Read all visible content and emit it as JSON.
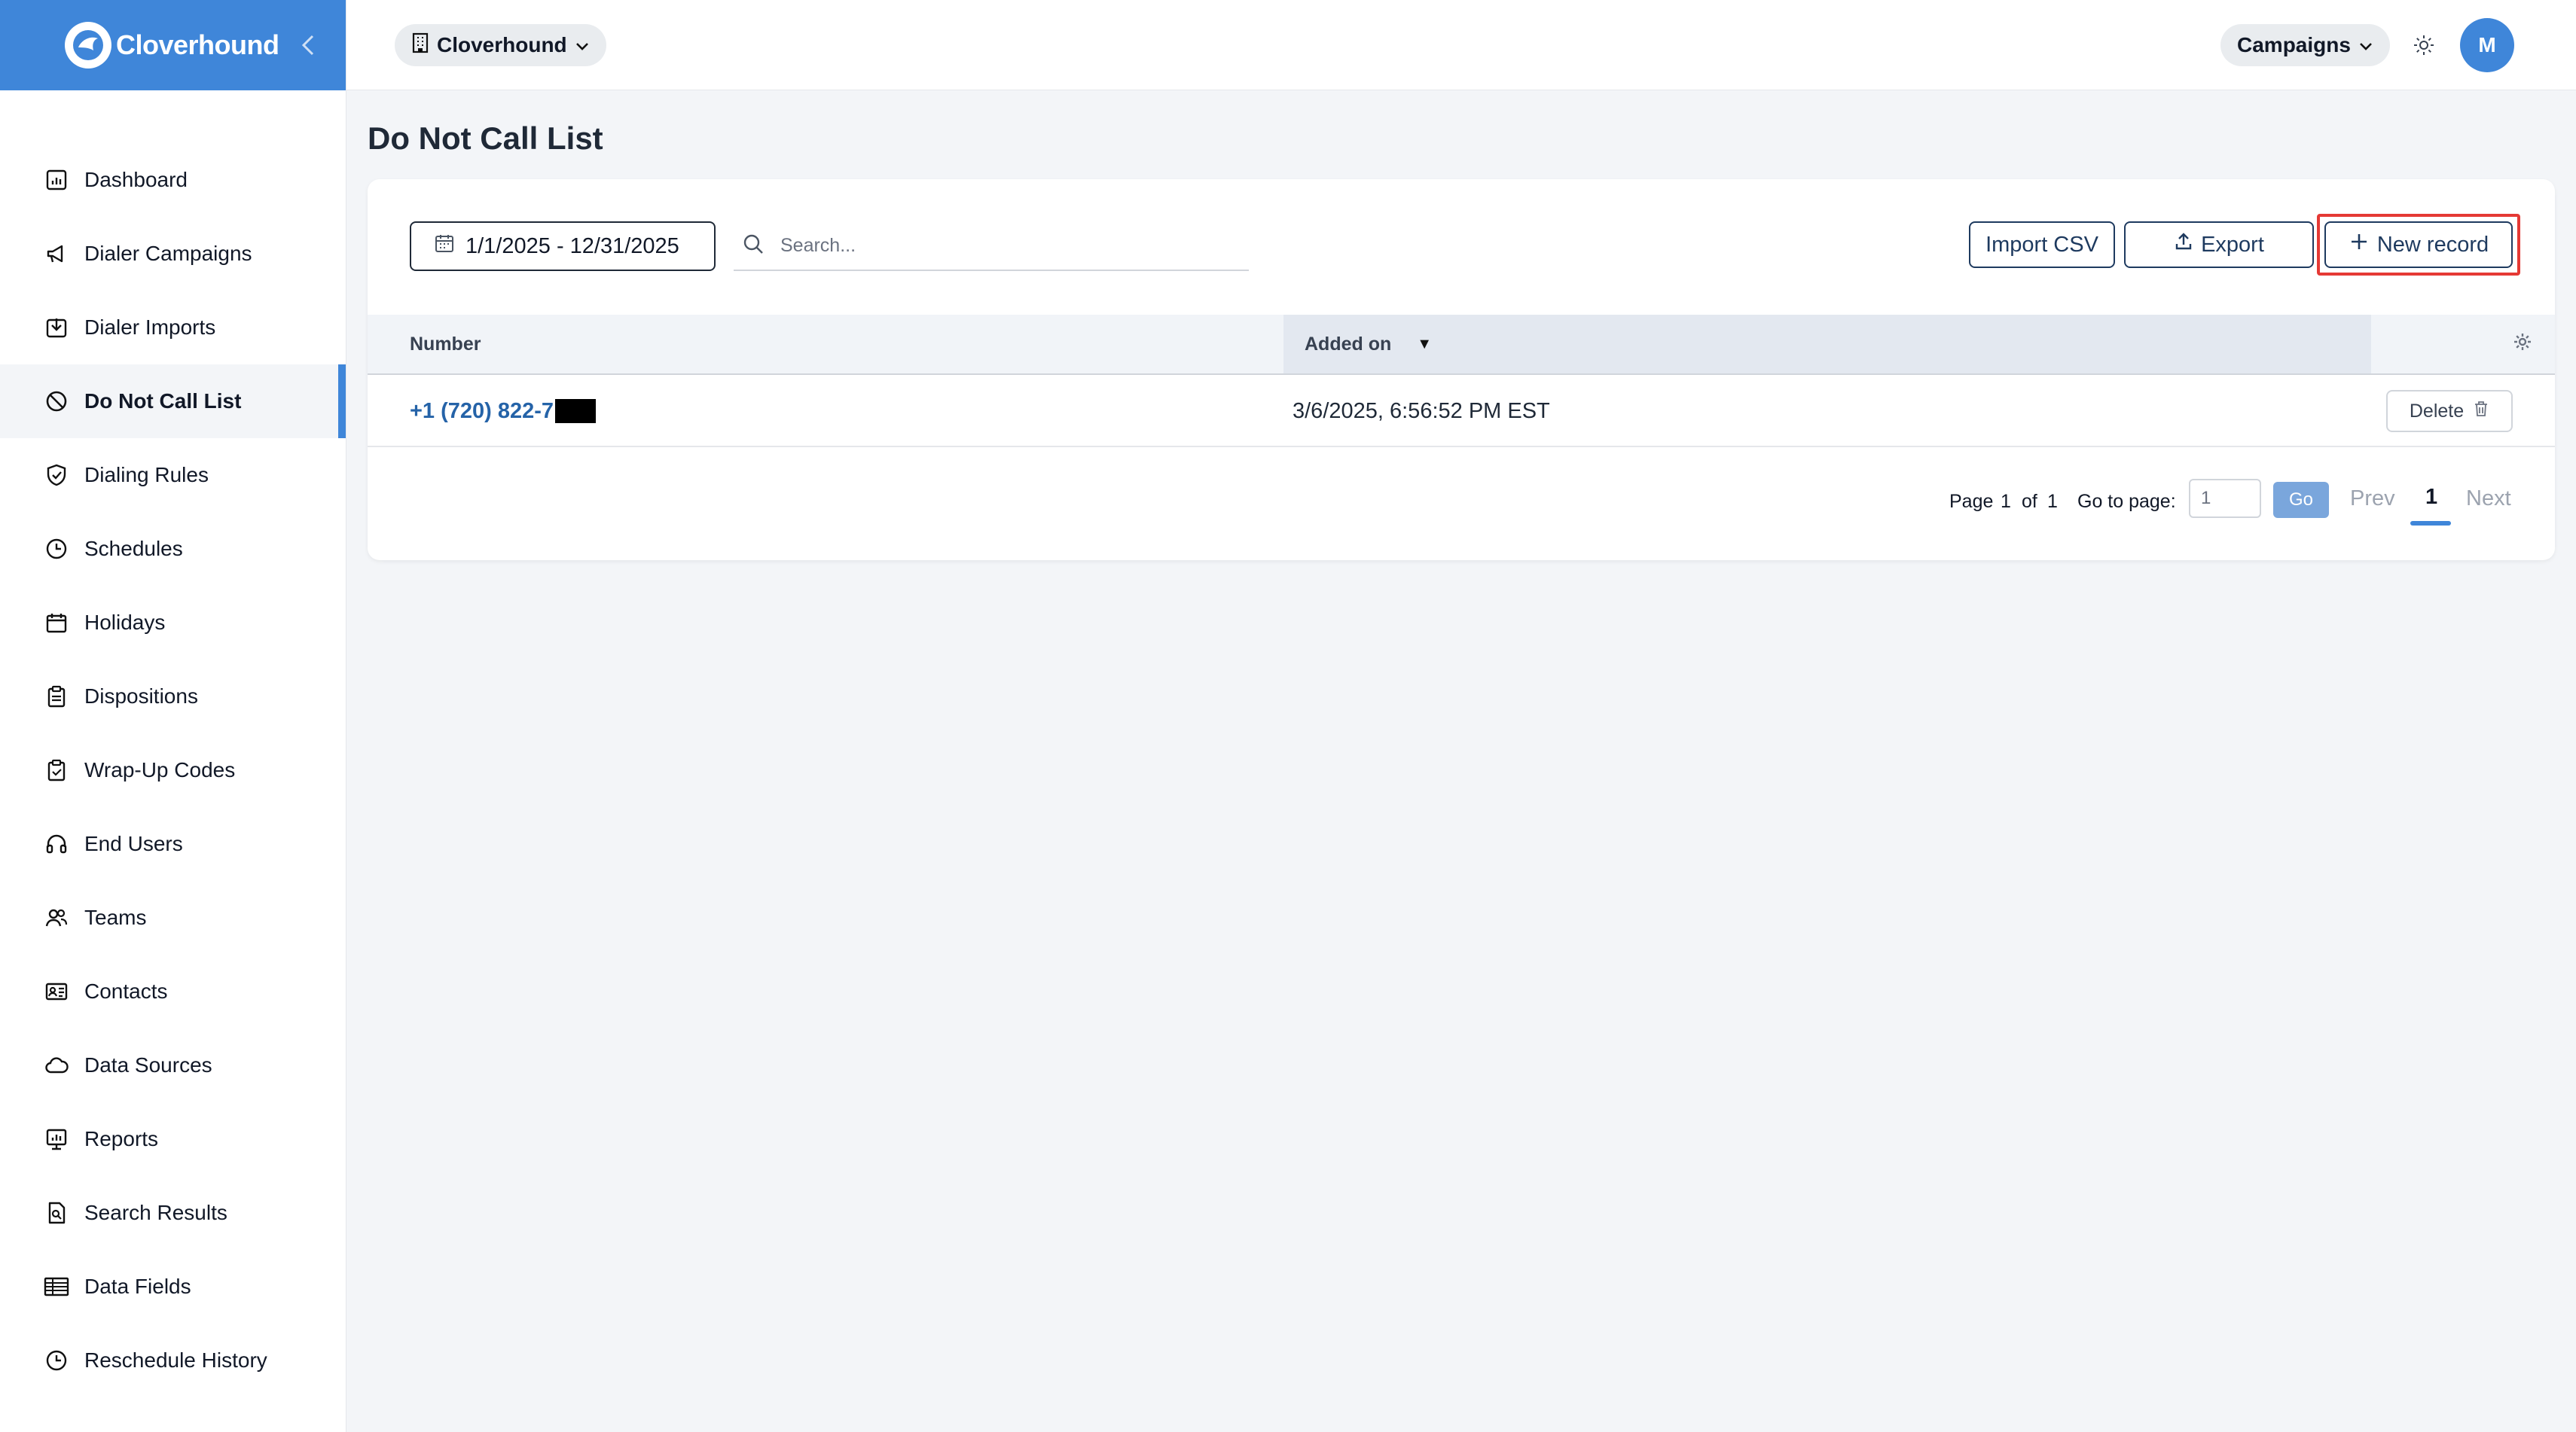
{
  "brand": {
    "name": "Cloverhound"
  },
  "colors": {
    "accent": "#3f86d9",
    "link": "#2563a8",
    "highlight": "#e53935"
  },
  "sidebar": {
    "items": [
      {
        "label": "Dashboard",
        "icon": "chart-icon"
      },
      {
        "label": "Dialer Campaigns",
        "icon": "megaphone-icon"
      },
      {
        "label": "Dialer Imports",
        "icon": "import-icon"
      },
      {
        "label": "Do Not Call List",
        "icon": "ban-icon",
        "active": true
      },
      {
        "label": "Dialing Rules",
        "icon": "shield-check-icon"
      },
      {
        "label": "Schedules",
        "icon": "clock-icon"
      },
      {
        "label": "Holidays",
        "icon": "calendar-icon"
      },
      {
        "label": "Dispositions",
        "icon": "clipboard-icon"
      },
      {
        "label": "Wrap-Up Codes",
        "icon": "clipboard-check-icon"
      },
      {
        "label": "End Users",
        "icon": "headset-icon"
      },
      {
        "label": "Teams",
        "icon": "users-icon"
      },
      {
        "label": "Contacts",
        "icon": "contact-card-icon"
      },
      {
        "label": "Data Sources",
        "icon": "cloud-icon"
      },
      {
        "label": "Reports",
        "icon": "report-icon"
      },
      {
        "label": "Search Results",
        "icon": "search-document-icon"
      },
      {
        "label": "Data Fields",
        "icon": "table-icon"
      },
      {
        "label": "Reschedule History",
        "icon": "history-icon"
      }
    ]
  },
  "topbar": {
    "org": "Cloverhound",
    "campaigns": "Campaigns",
    "avatar_initial": "M"
  },
  "page": {
    "title": "Do Not Call List"
  },
  "toolbar": {
    "date_range": "1/1/2025 - 12/31/2025",
    "search_placeholder": "Search...",
    "import_label": "Import CSV",
    "export_label": "Export",
    "new_label": "New record"
  },
  "table": {
    "columns": [
      "Number",
      "Added on"
    ],
    "sort_indicator": "▼",
    "rows": [
      {
        "number": "+1 (720) 822-7",
        "added_on": "3/6/2025, 6:56:52 PM EST",
        "action": "Delete"
      }
    ]
  },
  "pagination": {
    "page_label": "Page",
    "current": "1",
    "of_label": "of",
    "total": "1",
    "goto_label": "Go to page:",
    "goto_value": "1",
    "go_label": "Go",
    "prev_label": "Prev",
    "next_label": "Next"
  }
}
